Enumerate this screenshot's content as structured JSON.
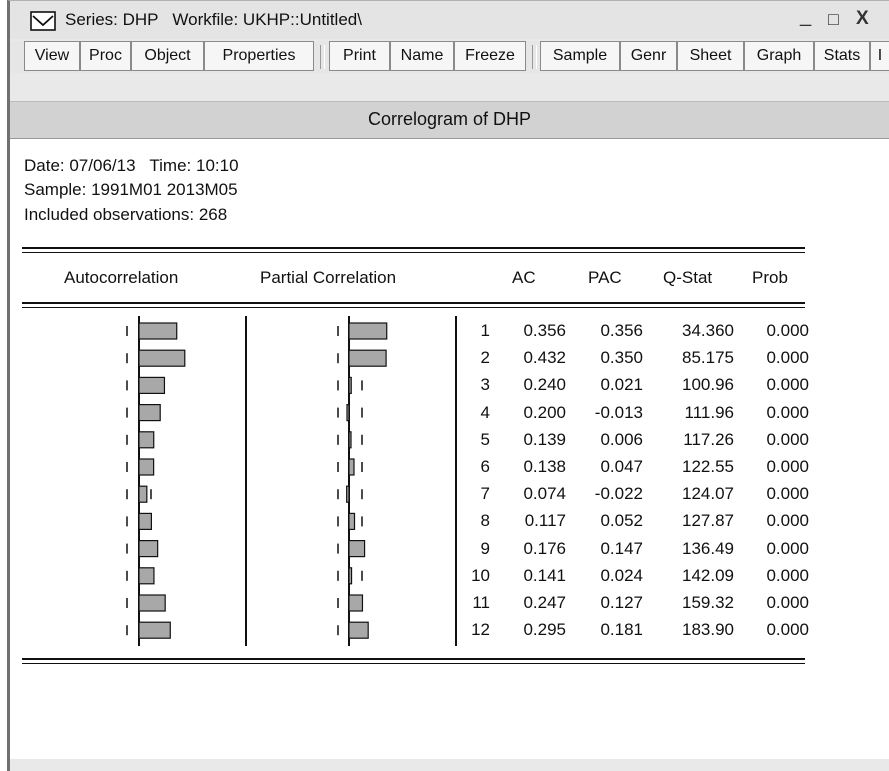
{
  "window": {
    "title": "Series: DHP   Workfile: UKHP::Untitled\\",
    "controls": {
      "minimize": "_",
      "maximize": "□",
      "close": "X"
    }
  },
  "toolbar": {
    "buttons": [
      "View",
      "Proc",
      "Object",
      "Properties",
      "Print",
      "Name",
      "Freeze",
      "Sample",
      "Genr",
      "Sheet",
      "Graph",
      "Stats",
      "I"
    ]
  },
  "view_title": "Correlogram of DHP",
  "info": {
    "date_line": "Date: 07/06/13   Time: 10:10",
    "sample_line": "Sample: 1991M01 2013M05",
    "obs_line": "Included observations: 268"
  },
  "headers": {
    "autocorrelation": "Autocorrelation",
    "partial": "Partial Correlation",
    "ac": "AC",
    "pac": "PAC",
    "qstat": "Q-Stat",
    "prob": "Prob"
  },
  "rows": [
    {
      "lag": "1",
      "ac": "0.356",
      "pac": "0.356",
      "q": "34.360",
      "prob": "0.000"
    },
    {
      "lag": "2",
      "ac": "0.432",
      "pac": "0.350",
      "q": "85.175",
      "prob": "0.000"
    },
    {
      "lag": "3",
      "ac": "0.240",
      "pac": "0.021",
      "q": "100.96",
      "prob": "0.000"
    },
    {
      "lag": "4",
      "ac": "0.200",
      "pac": "-0.013",
      "q": "111.96",
      "prob": "0.000"
    },
    {
      "lag": "5",
      "ac": "0.139",
      "pac": "0.006",
      "q": "117.26",
      "prob": "0.000"
    },
    {
      "lag": "6",
      "ac": "0.138",
      "pac": "0.047",
      "q": "122.55",
      "prob": "0.000"
    },
    {
      "lag": "7",
      "ac": "0.074",
      "pac": "-0.022",
      "q": "124.07",
      "prob": "0.000"
    },
    {
      "lag": "8",
      "ac": "0.117",
      "pac": "0.052",
      "q": "127.87",
      "prob": "0.000"
    },
    {
      "lag": "9",
      "ac": "0.176",
      "pac": "0.147",
      "q": "136.49",
      "prob": "0.000"
    },
    {
      "lag": "10",
      "ac": "0.141",
      "pac": "0.024",
      "q": "142.09",
      "prob": "0.000"
    },
    {
      "lag": "11",
      "ac": "0.247",
      "pac": "0.127",
      "q": "159.32",
      "prob": "0.000"
    },
    {
      "lag": "12",
      "ac": "0.295",
      "pac": "0.181",
      "q": "183.90",
      "prob": "0.000"
    }
  ],
  "colors": {
    "bar_fill": "#a8a8a8",
    "bar_stroke": "#111111"
  }
}
